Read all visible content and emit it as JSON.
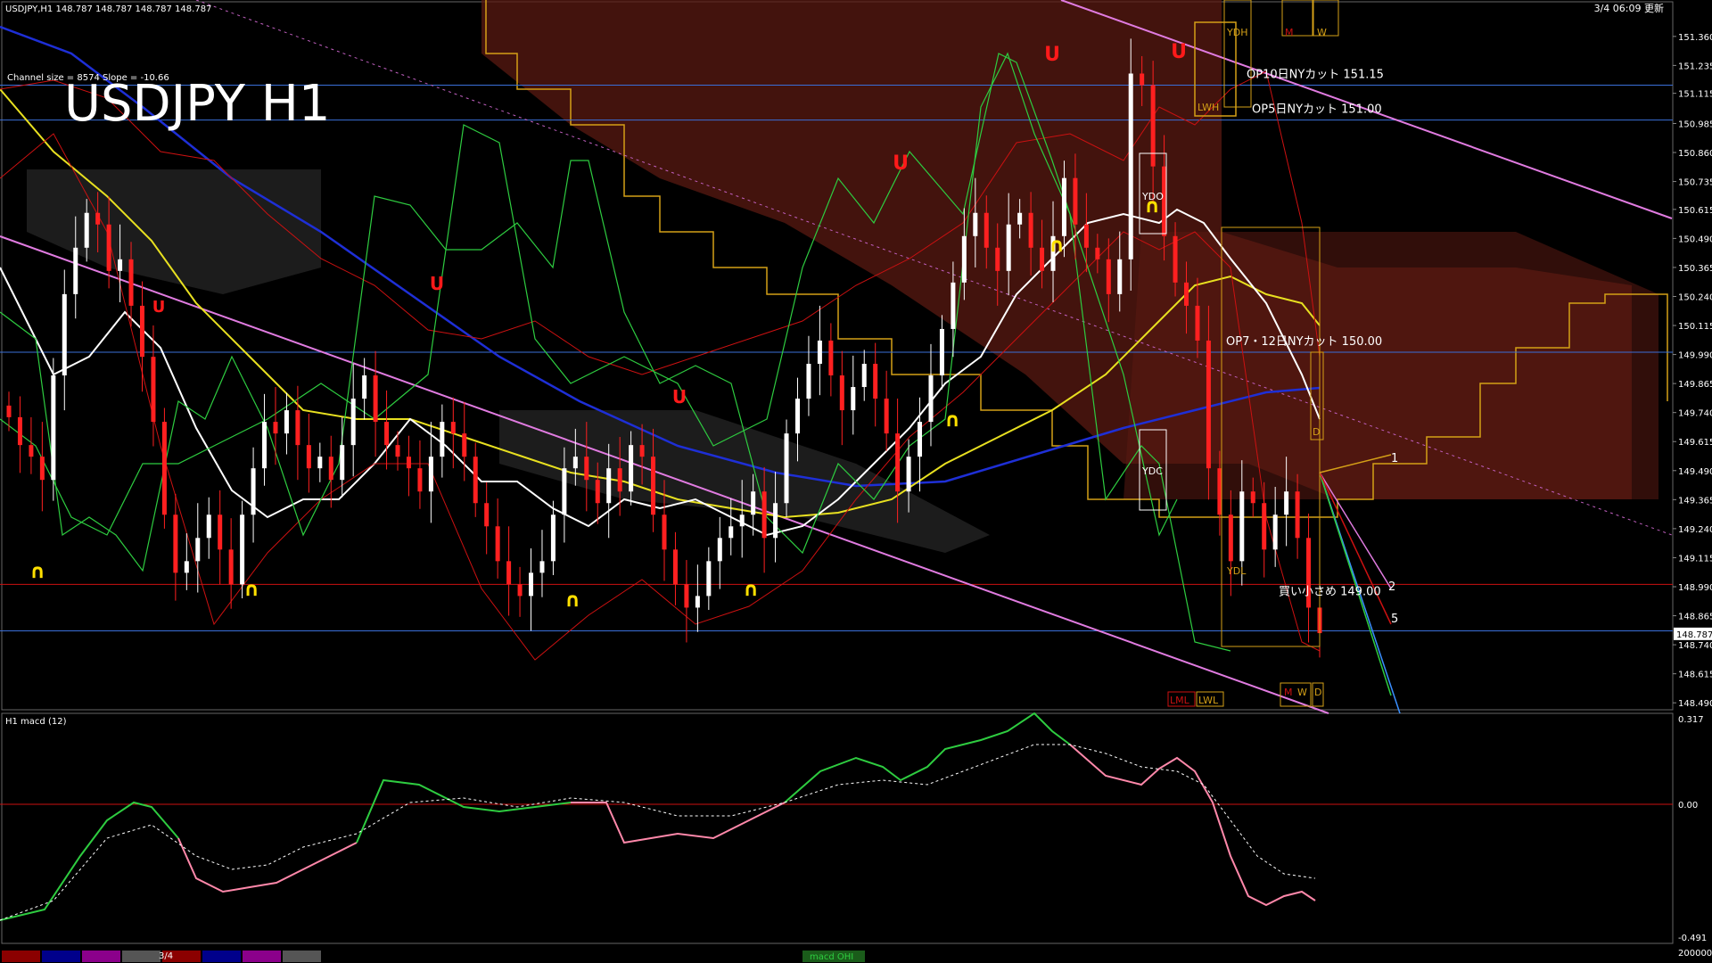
{
  "header": {
    "symbol_info": "USDJPY,H1  148.787 148.787 148.787 148.787",
    "channel_info": "Channel size = 8574 Slope = -10.66",
    "datetime": "3/4 06:09 更新"
  },
  "title": "USDJPY H1",
  "price_axis": {
    "labels": [
      "151.360",
      "151.235",
      "151.115",
      "150.985",
      "150.860",
      "150.735",
      "150.615",
      "150.490",
      "150.365",
      "150.240",
      "150.115",
      "149.990",
      "149.865",
      "149.740",
      "149.615",
      "149.490",
      "149.365",
      "149.240",
      "149.115",
      "148.990",
      "148.865",
      "148.740",
      "148.615",
      "148.490"
    ],
    "current": "148.787",
    "range": [
      148.46,
      151.44
    ]
  },
  "indicator": {
    "name": "H1  macd (12)",
    "axis_labels": [
      "0.317",
      "0.00",
      "-0.491"
    ],
    "range": [
      -0.491,
      0.317
    ],
    "footer": "200000"
  },
  "annotations": [
    {
      "text": "OP10日NYカット 151.15",
      "price": 151.15
    },
    {
      "text": "OP5日NYカット 151.00",
      "price": 151.0
    },
    {
      "text": "OP7・12日NYカット 150.00",
      "price": 150.0
    },
    {
      "text": "買い小さめ 149.00",
      "price": 149.0
    }
  ],
  "box_labels": [
    "YDH",
    "M",
    "W",
    "LWH",
    "YDO",
    "YDC",
    "YDL",
    "LML",
    "LWL",
    "M",
    "W",
    "D",
    "D"
  ],
  "right_numbers": [
    "1",
    "2",
    "5"
  ],
  "toolbar": {
    "date_label": "3/4",
    "macd_label": "macd OHI",
    "colors": [
      "#8b0000",
      "#00008b",
      "#8b008b",
      "#555555",
      "#8b0000",
      "#00008b",
      "#8b008b",
      "#555555"
    ]
  },
  "chart_data": {
    "type": "candlestick",
    "title": "USDJPY H1",
    "ylim": [
      148.46,
      151.44
    ],
    "horizontal_lines": [
      151.15,
      151.0,
      150.0,
      149.0,
      148.8
    ],
    "series": [
      {
        "name": "close",
        "values": [
          149.72,
          149.6,
          149.55,
          149.45,
          149.9,
          150.25,
          150.45,
          150.6,
          150.55,
          150.35,
          150.4,
          150.2,
          149.98,
          149.7,
          149.3,
          149.05,
          149.1,
          149.2,
          149.3,
          149.15,
          149.0,
          149.3,
          149.5,
          149.7,
          149.65,
          149.75,
          149.6,
          149.5,
          149.55,
          149.45,
          149.6,
          149.8,
          149.9,
          149.7,
          149.6,
          149.55,
          149.5,
          149.4,
          149.55,
          149.7,
          149.65,
          149.55,
          149.35,
          149.25,
          149.1,
          149.0,
          148.95,
          149.05,
          149.1,
          149.3,
          149.5,
          149.55,
          149.45,
          149.35,
          149.5,
          149.4,
          149.6,
          149.55,
          149.3,
          149.15,
          149.0,
          148.9,
          148.95,
          149.1,
          149.2,
          149.25,
          149.3,
          149.4,
          149.2,
          149.35,
          149.65,
          149.8,
          149.95,
          150.05,
          149.9,
          149.75,
          149.85,
          149.95,
          149.8,
          149.65,
          149.4,
          149.55,
          149.7,
          149.9,
          150.1,
          150.3,
          150.5,
          150.6,
          150.45,
          150.35,
          150.55,
          150.6,
          150.45,
          150.35,
          150.5,
          150.75,
          150.55,
          150.45,
          150.4,
          150.25,
          150.4,
          151.2,
          151.15,
          150.8,
          150.5,
          150.3,
          150.2,
          150.05,
          149.5,
          149.3,
          149.1,
          149.4,
          149.35,
          149.15,
          149.3,
          149.4,
          149.2,
          148.9,
          148.79
        ]
      }
    ]
  }
}
